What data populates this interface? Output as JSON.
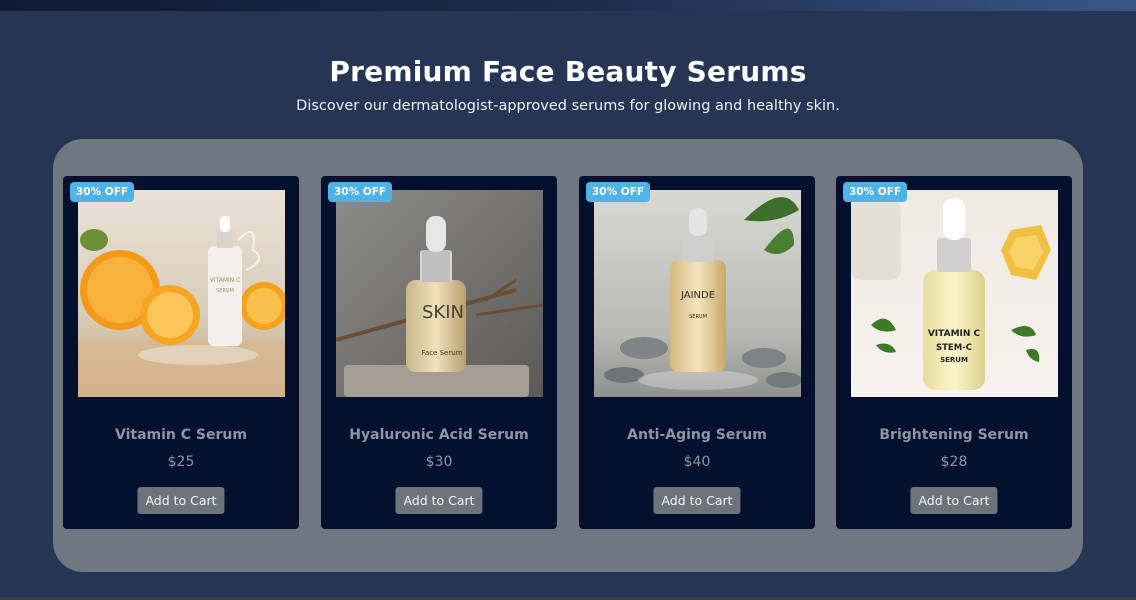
{
  "header": {
    "title": "Premium Face Beauty Serums",
    "subtitle": "Discover our dermatologist-approved serums for glowing and healthy skin."
  },
  "products": [
    {
      "badge": "30% OFF",
      "name": "Vitamin C Serum",
      "price": "$25",
      "button": "Add to Cart",
      "image_text": [
        "VITAMIN C",
        "SERUM"
      ]
    },
    {
      "badge": "30% OFF",
      "name": "Hyaluronic Acid Serum",
      "price": "$30",
      "button": "Add to Cart",
      "image_text": [
        "SKIN",
        "Face Serum"
      ]
    },
    {
      "badge": "30% OFF",
      "name": "Anti-Aging Serum",
      "price": "$40",
      "button": "Add to Cart",
      "image_text": [
        "JAINDE",
        "SERUM"
      ]
    },
    {
      "badge": "30% OFF",
      "name": "Brightening Serum",
      "price": "$28",
      "button": "Add to Cart",
      "image_text": [
        "VITAMIN C",
        "STEM-C",
        "SERUM"
      ]
    }
  ],
  "colors": {
    "background": "#253553",
    "panel": "#6f7780",
    "card": "#03112f",
    "badge": "#4fb3e8",
    "button": "#6c737b"
  }
}
